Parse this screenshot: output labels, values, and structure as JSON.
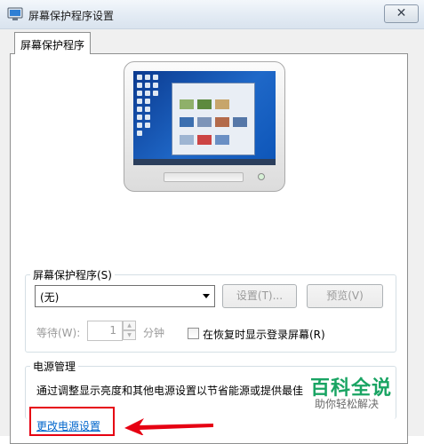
{
  "window": {
    "title": "屏幕保护程序设置",
    "close_glyph": "✕"
  },
  "tabs": [
    {
      "label": "屏幕保护程序"
    }
  ],
  "screensaver": {
    "group_label": "屏幕保护程序(S)",
    "selected": "(无)",
    "settings_button": "设置(T)...",
    "preview_button": "预览(V)",
    "wait_label": "等待(W):",
    "wait_value": "1",
    "wait_unit": "分钟",
    "resume_checkbox_label": "在恢复时显示登录屏幕(R)",
    "resume_checked": false
  },
  "power": {
    "group_label": "电源管理",
    "description": "通过调整显示亮度和其他电源设置以节省能源或提供最佳",
    "link": "更改电源设置"
  },
  "watermark": {
    "main": "百科全说",
    "sub": "助你轻松解决",
    "color": "#19a463"
  },
  "annotation": {
    "highlight_color": "#e60012"
  },
  "icons": {
    "app": "screensaver-settings-icon",
    "close": "close-icon",
    "dropdown": "chevron-down-icon"
  }
}
